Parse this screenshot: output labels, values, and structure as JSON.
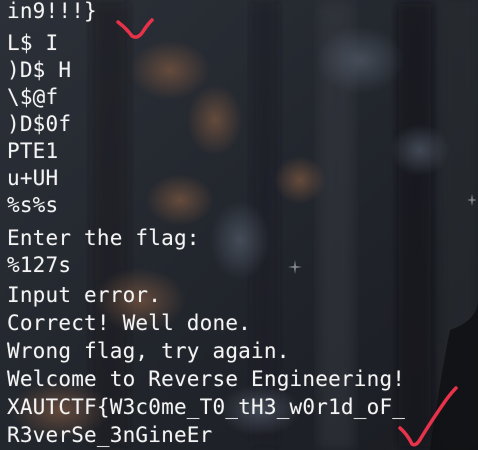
{
  "terminal": {
    "lines": [
      "in9!!!}",
      "L$ I",
      ")D$ H",
      "\\$@f",
      ")D$0f",
      "PTE1",
      "u+UH",
      "%s%s",
      "Enter the flag:",
      "%127s",
      "Input error.",
      "Correct! Well done.",
      "Wrong flag, try again.",
      "Welcome to Reverse Engineering!",
      "XAUTCTF{W3c0me_T0_tH3_w0r1d_oF_",
      "R3verSe_3nGineEr"
    ]
  },
  "colors": {
    "text": "#f4f4f4",
    "background": "#23272e",
    "annotation": "#e8324a"
  },
  "icons": {
    "background_sparkle": "sparkle-icon",
    "annotation_mark": "checkmark-icon"
  }
}
